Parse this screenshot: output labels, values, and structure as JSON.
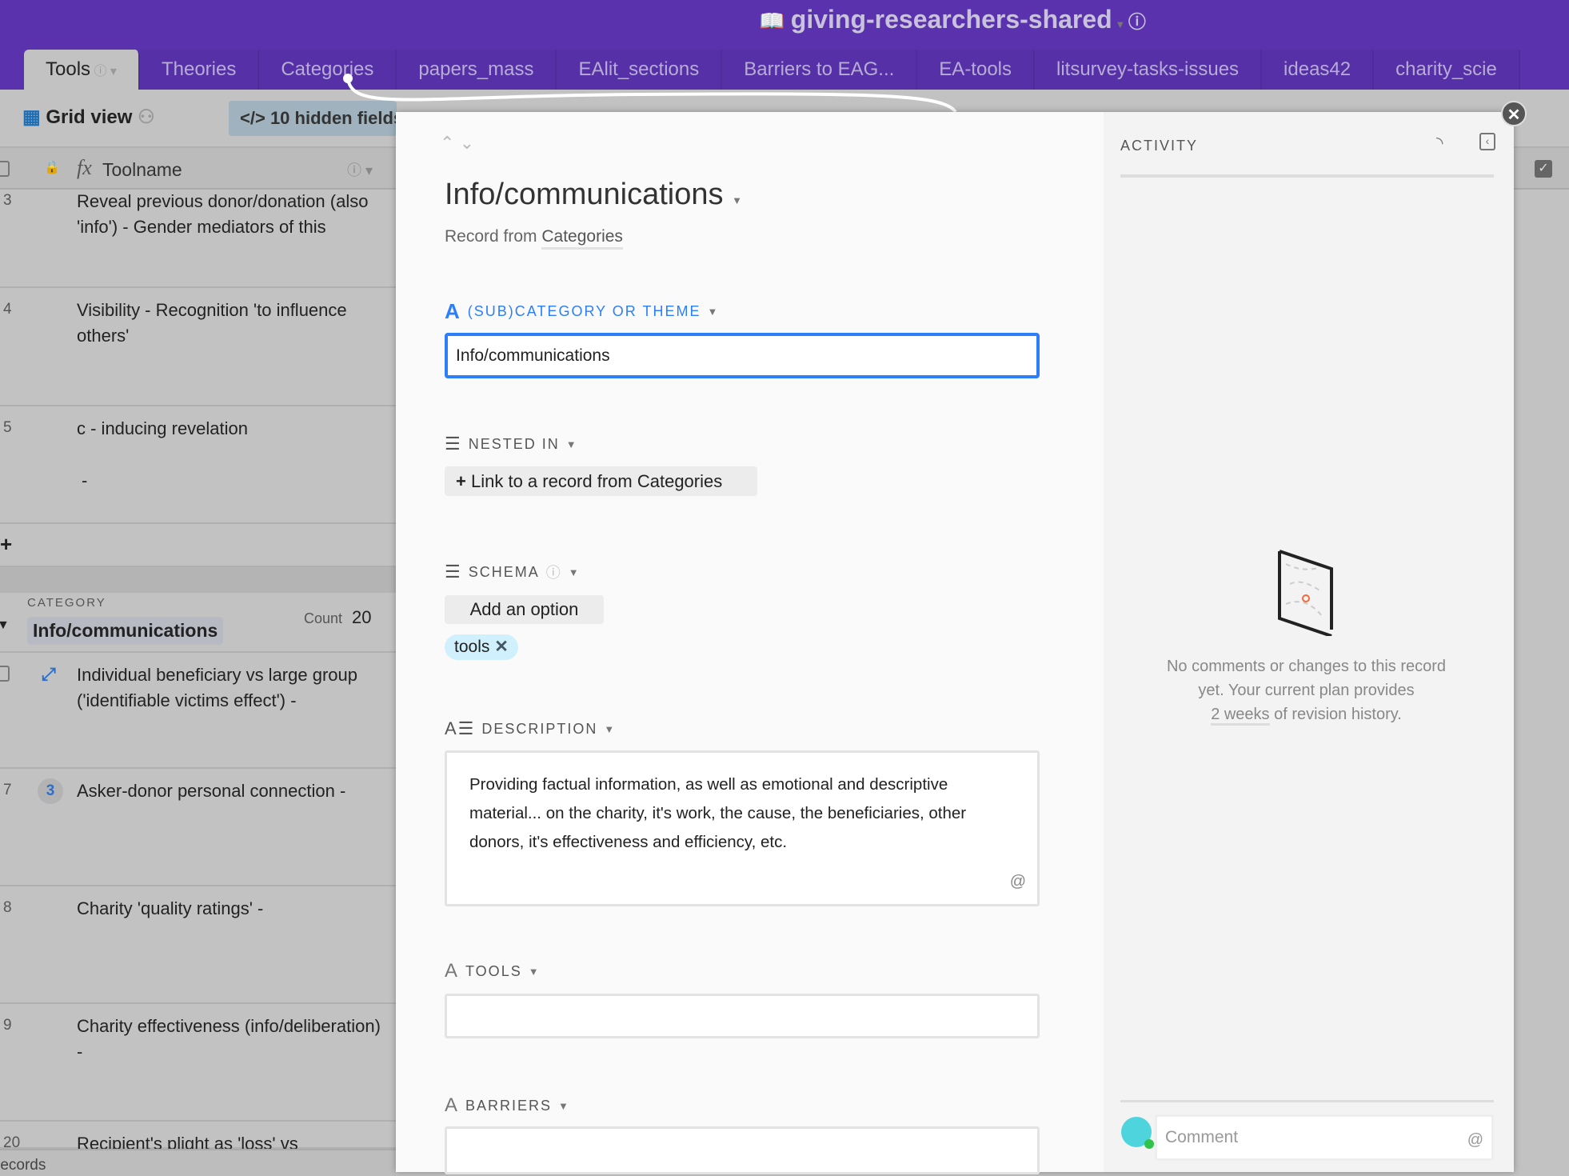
{
  "app": {
    "base_title": "giving-researchers-shared"
  },
  "tabs": [
    {
      "label": "Tools",
      "active": true
    },
    {
      "label": "Theories"
    },
    {
      "label": "Categories"
    },
    {
      "label": "papers_mass"
    },
    {
      "label": "EAlit_sections"
    },
    {
      "label": "Barriers to EAG..."
    },
    {
      "label": "EA-tools"
    },
    {
      "label": "litsurvey-tasks-issues"
    },
    {
      "label": "ideas42"
    },
    {
      "label": "charity_scie"
    }
  ],
  "toolbar": {
    "view_name": "Grid view",
    "hidden_fields": "10 hidden fields"
  },
  "grid": {
    "primary_column": "Toolname",
    "rows_top": [
      {
        "num": "3",
        "text": "Reveal previous donor/donation (also 'info') - Gender mediators of this"
      },
      {
        "num": "4",
        "text": "Visibility - Recognition 'to influence others'"
      },
      {
        "num": "5",
        "text": "c - inducing revelation",
        "extra": "-"
      }
    ],
    "add_row": "+",
    "group": {
      "label": "CATEGORY",
      "value": "Info/communications",
      "count_label": "Count",
      "count": "20"
    },
    "rows_group": [
      {
        "num": "",
        "text": "Individual beneficiary vs large group ('identifiable victims effect') -"
      },
      {
        "num": "7",
        "badge": "3",
        "text": "Asker-donor personal connection  -"
      },
      {
        "num": "8",
        "text": "Charity 'quality ratings' -"
      },
      {
        "num": "9",
        "text": "Charity effectiveness (info/deliberation) -"
      },
      {
        "num": "20",
        "text": "Recipient's plight as 'loss' vs"
      }
    ],
    "footer": "records"
  },
  "record": {
    "title": "Info/communications",
    "subtitle_prefix": "Record from",
    "subtitle_table": "Categories",
    "fields": {
      "subcategory": {
        "label": "(SUB)CATEGORY OR THEME",
        "value": "Info/communications"
      },
      "nested_in": {
        "label": "NESTED IN",
        "link_button": "Link to a record from Categories"
      },
      "schema": {
        "label": "SCHEMA",
        "add_option": "Add an option",
        "chips": [
          "tools"
        ]
      },
      "description": {
        "label": "DESCRIPTION",
        "value": "Providing factual information, as well as emotional and descriptive material...  on the charity, it's work, the cause, the beneficiaries, other donors, it's effectiveness and efficiency, etc."
      },
      "tools": {
        "label": "TOOLS",
        "value": ""
      },
      "barriers": {
        "label": "BARRIERS",
        "value": ""
      }
    }
  },
  "activity": {
    "title": "ACTIVITY",
    "empty_line1": "No comments or changes to this record",
    "empty_line2": "yet. Your current plan provides",
    "empty_link": "2 weeks",
    "empty_line3": " of revision history.",
    "comment_placeholder": "Comment"
  },
  "colors": {
    "brand": "#5a32ae",
    "accent": "#2d7ff9",
    "chip": "#d0f0fd"
  }
}
